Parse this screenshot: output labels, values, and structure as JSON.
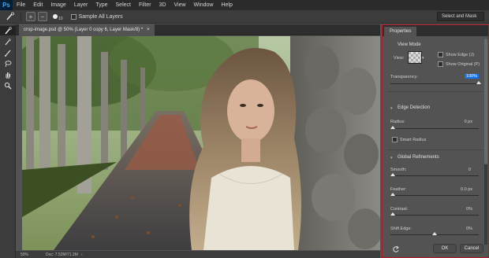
{
  "app": {
    "logo": "Ps"
  },
  "menu": [
    "File",
    "Edit",
    "Image",
    "Layer",
    "Type",
    "Select",
    "Filter",
    "3D",
    "View",
    "Window",
    "Help"
  ],
  "options": {
    "brush_size": "10",
    "sample_all_layers": "Sample All Layers",
    "select_and_mask": "Select and Mask"
  },
  "document": {
    "tab_title": "crop-image.psd @ 50% (Layer 0 copy 6, Layer Mask/8) *",
    "close": "×"
  },
  "status": {
    "zoom": "50%",
    "doc": "Doc: 7.52M/71.3M",
    "arrow": "›"
  },
  "properties": {
    "tab": "Properties",
    "view_mode": {
      "title": "View Mode",
      "view_label": "View:",
      "show_edge": "Show Edge (J)",
      "show_original": "Show Original (P)"
    },
    "transparency": {
      "label": "Transparency:",
      "value": "100%",
      "level_pct": 100
    },
    "edge_detection": {
      "title": "Edge Detection",
      "radius_label": "Radius:",
      "radius_value": "0 px",
      "smart_radius": "Smart Radius"
    },
    "global_refinements": {
      "title": "Global Refinements",
      "smooth_label": "Smooth:",
      "smooth_value": "0",
      "feather_label": "Feather:",
      "feather_value": "0.0 px",
      "contrast_label": "Contrast:",
      "contrast_value": "0%",
      "shift_edge_label": "Shift Edge:",
      "shift_edge_value": "0%"
    },
    "buttons": {
      "ok": "OK",
      "cancel": "Cancel"
    }
  },
  "colors": {
    "panel_border": "#b01a2a",
    "highlight": "#1473e6"
  }
}
